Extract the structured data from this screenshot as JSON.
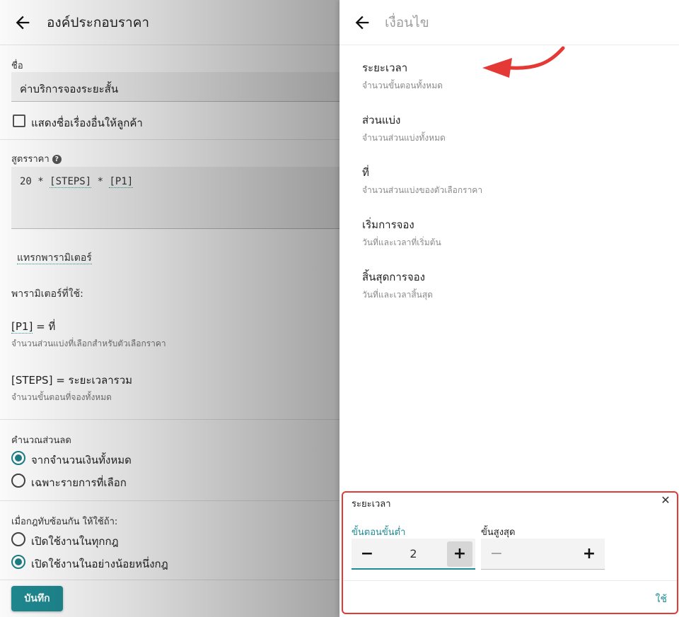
{
  "left": {
    "title": "องค์ประกอบราคา",
    "name_label": "ชื่อ",
    "name_value": "ค่าบริการจองระยะสั้น",
    "show_other_name_label": "แสดงชื่อเรื่องอื่นให้ลูกค้า",
    "formula_label": "สูตรราคา",
    "formula_parts": [
      "20 * ",
      "[STEPS]",
      " * ",
      "[P1]"
    ],
    "insert_param_label": "แทรกพารามิเตอร์",
    "params_used_label": "พารามิเตอร์ที่ใช้:",
    "params": [
      {
        "token": "[P1]",
        "name": " = ที่",
        "desc": "จำนวนส่วนแบ่งที่เลือกสำหรับตัวเลือกราคา"
      },
      {
        "token": "[STEPS]",
        "name": " = ระยะเวลารวม",
        "desc": "จำนวนขั้นตอนที่จองทั้งหมด"
      }
    ],
    "discount_label": "คำนวณส่วนลด",
    "discount_options": [
      "จากจำนวนเงินทั้งหมด",
      "เฉพาะรายการที่เลือก"
    ],
    "discount_selected": 0,
    "overlap_label": "เมื่อกฎทับซ้อนกัน ให้ใช้ถ้า:",
    "overlap_options": [
      "เปิดใช้งานในทุกกฎ",
      "เปิดใช้งานในอย่างน้อยหนึ่งกฎ"
    ],
    "overlap_selected": 1,
    "save_label": "บันทึก"
  },
  "right": {
    "title": "เงื่อนไข",
    "options": [
      {
        "title": "ระยะเวลา",
        "desc": "จำนวนขั้นตอนทั้งหมด"
      },
      {
        "title": "ส่วนแบ่ง",
        "desc": "จำนวนส่วนแบ่งทั้งหมด"
      },
      {
        "title": "ที่",
        "desc": "จำนวนส่วนแบ่งของตัวเลือกราคา"
      },
      {
        "title": "เริ่มการจอง",
        "desc": "วันที่และเวลาที่เริ่มต้น"
      },
      {
        "title": "สิ้นสุดการจอง",
        "desc": "วันที่และเวลาสิ้นสุด"
      }
    ]
  },
  "dialog": {
    "title": "ระยะเวลา",
    "min_label": "ขั้นตอนขั้นต่ำ",
    "min_value": "2",
    "max_label": "ขั้นสูงสุด",
    "max_value": "",
    "apply_label": "ใช้",
    "minus": "−",
    "plus": "+"
  },
  "colors": {
    "accent": "#1f8a92",
    "annotation": "#e53935"
  },
  "icons": [
    "back-arrow-icon",
    "help-icon",
    "close-icon",
    "minus-icon",
    "plus-icon"
  ]
}
